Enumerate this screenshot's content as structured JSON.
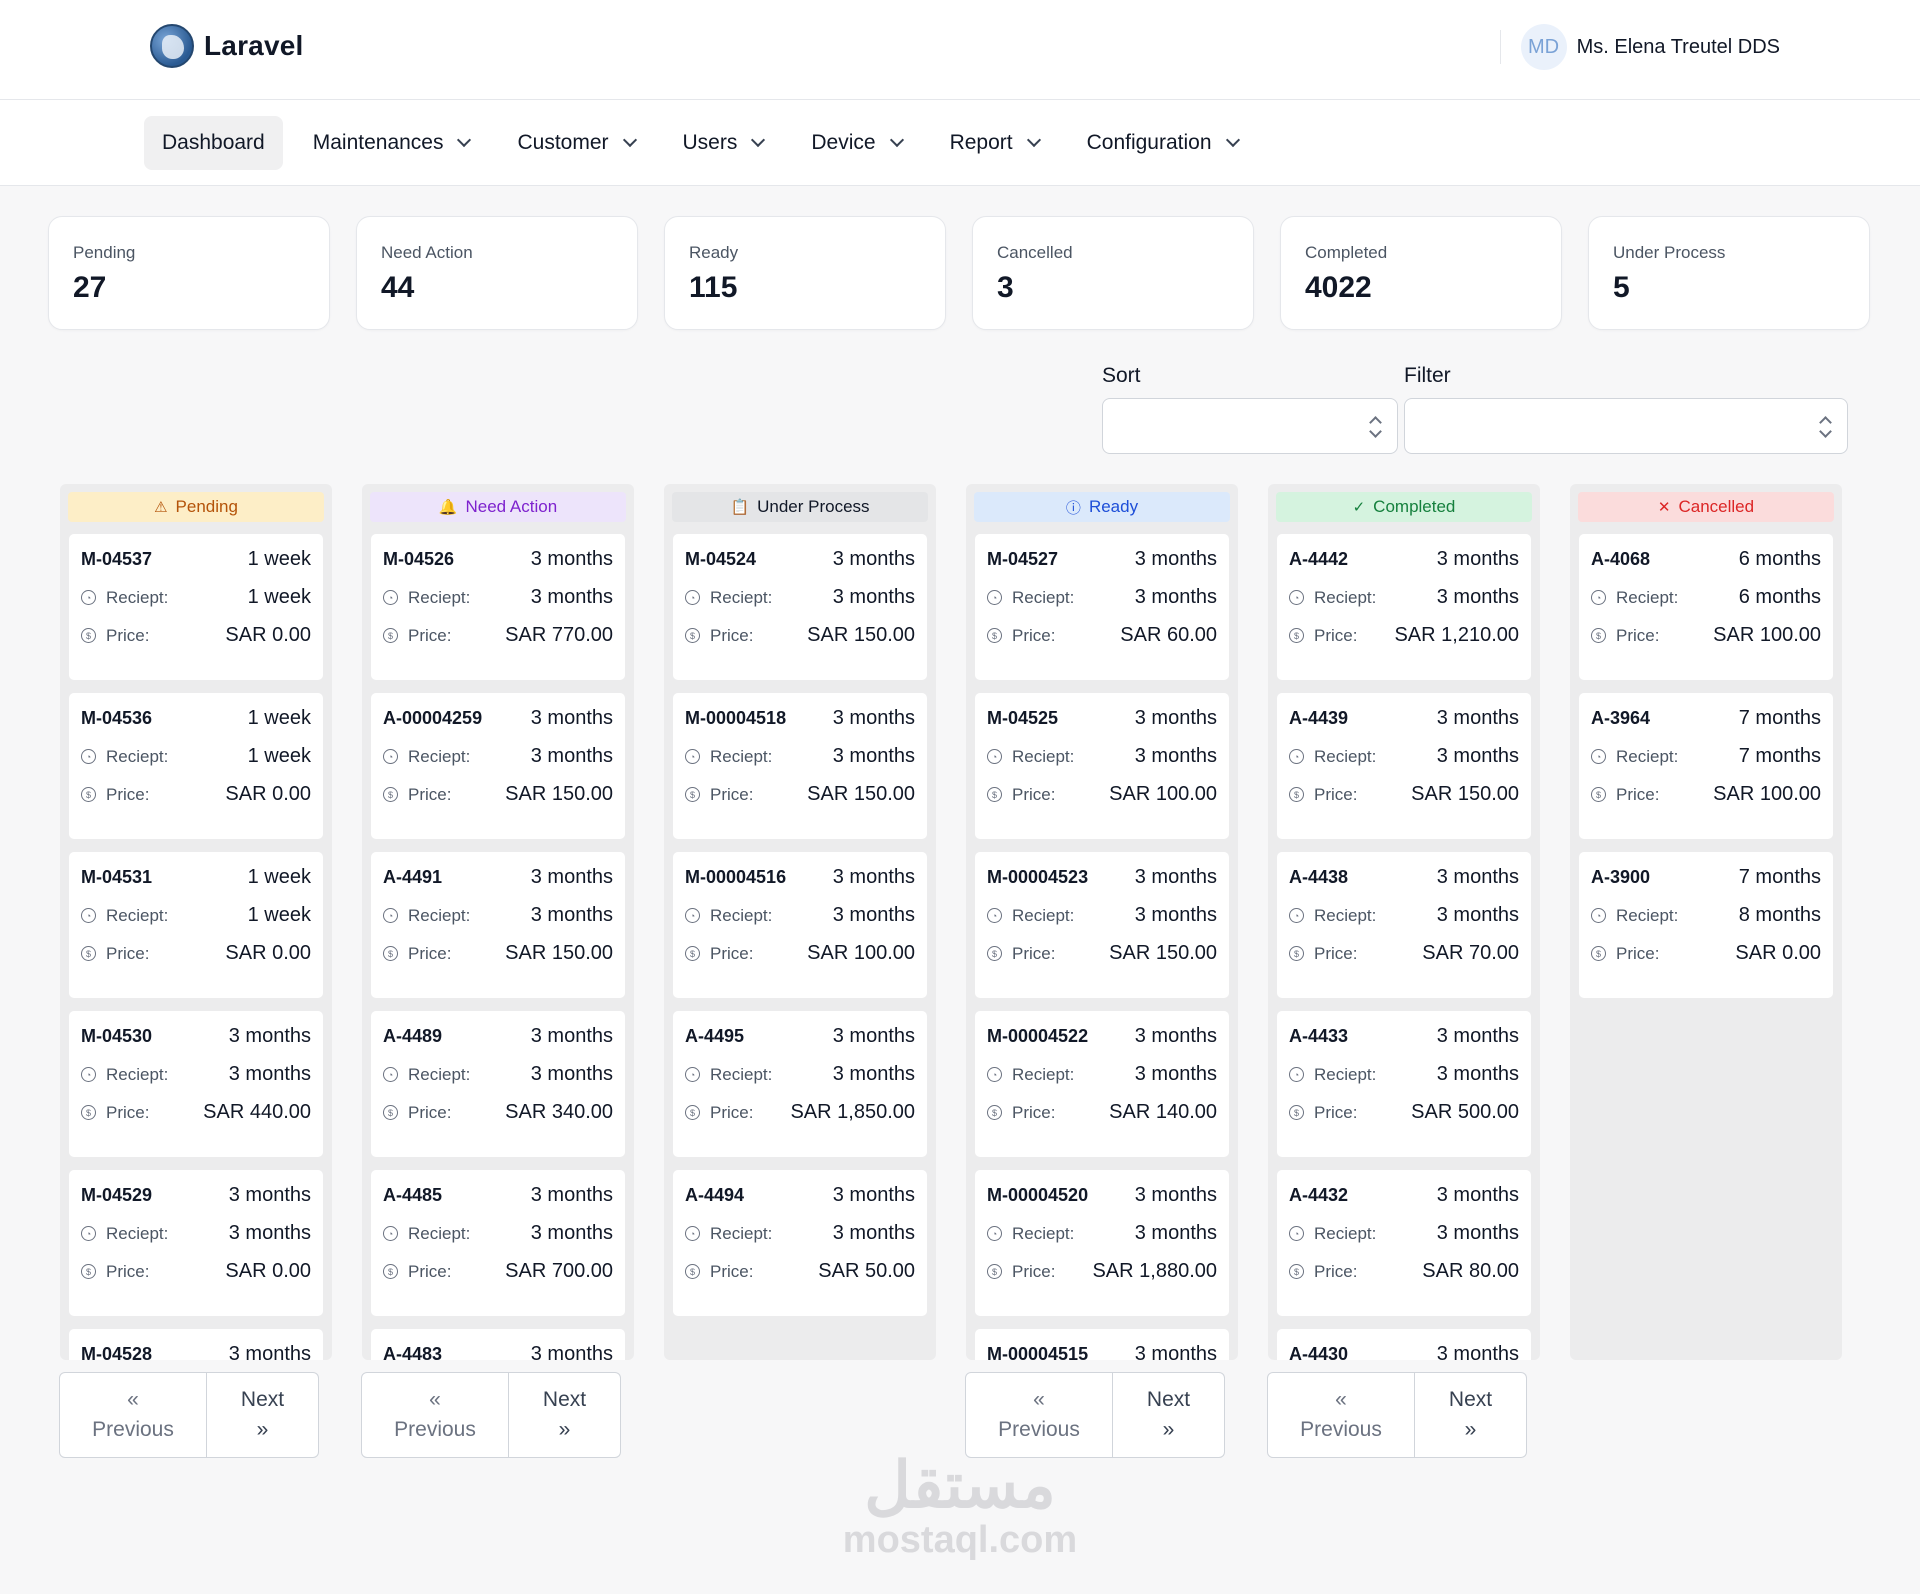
{
  "brand": {
    "name": "Laravel"
  },
  "user": {
    "initials": "MD",
    "name": "Ms. Elena Treutel DDS"
  },
  "nav": [
    {
      "label": "Dashboard"
    },
    {
      "label": "Maintenances"
    },
    {
      "label": "Customer"
    },
    {
      "label": "Users"
    },
    {
      "label": "Device"
    },
    {
      "label": "Report"
    },
    {
      "label": "Configuration"
    }
  ],
  "stats": [
    {
      "label": "Pending",
      "value": "27"
    },
    {
      "label": "Need Action",
      "value": "44"
    },
    {
      "label": "Ready",
      "value": "115"
    },
    {
      "label": "Cancelled",
      "value": "3"
    },
    {
      "label": "Completed",
      "value": "4022"
    },
    {
      "label": "Under Process",
      "value": "5"
    }
  ],
  "controls": {
    "sort_label": "Sort",
    "filter_label": "Filter",
    "sort_value": "",
    "filter_value": ""
  },
  "labels": {
    "receipt": "Reciept:",
    "price": "Price:"
  },
  "pager": {
    "prev_symbol": "«",
    "prev_label": "Previous",
    "next_label": "Next",
    "next_symbol": "»"
  },
  "columns": [
    {
      "title": "Pending",
      "icon": "warning-icon",
      "glyph": "⚠",
      "bg": "#fdeec7",
      "fg": "#b45309",
      "pager": true,
      "cards": [
        {
          "code": "M-04537",
          "time": "1 week",
          "receipt": "1 week",
          "price": "SAR 0.00"
        },
        {
          "code": "M-04536",
          "time": "1 week",
          "receipt": "1 week",
          "price": "SAR 0.00"
        },
        {
          "code": "M-04531",
          "time": "1 week",
          "receipt": "1 week",
          "price": "SAR 0.00"
        },
        {
          "code": "M-04530",
          "time": "3 months",
          "receipt": "3 months",
          "price": "SAR 440.00"
        },
        {
          "code": "M-04529",
          "time": "3 months",
          "receipt": "3 months",
          "price": "SAR 0.00"
        },
        {
          "code": "M-04528",
          "time": "3 months",
          "receipt": "",
          "price": ""
        }
      ]
    },
    {
      "title": "Need Action",
      "icon": "bell-icon",
      "glyph": "🔔",
      "bg": "#ede4fb",
      "fg": "#7e22ce",
      "pager": true,
      "cards": [
        {
          "code": "M-04526",
          "time": "3 months",
          "receipt": "3 months",
          "price": "SAR 770.00"
        },
        {
          "code": "A-00004259",
          "time": "3 months",
          "receipt": "3 months",
          "price": "SAR 150.00"
        },
        {
          "code": "A-4491",
          "time": "3 months",
          "receipt": "3 months",
          "price": "SAR 150.00"
        },
        {
          "code": "A-4489",
          "time": "3 months",
          "receipt": "3 months",
          "price": "SAR 340.00"
        },
        {
          "code": "A-4485",
          "time": "3 months",
          "receipt": "3 months",
          "price": "SAR 700.00"
        },
        {
          "code": "A-4483",
          "time": "3 months",
          "receipt": "",
          "price": ""
        }
      ]
    },
    {
      "title": "Under Process",
      "icon": "clipboard-icon",
      "glyph": "📋",
      "bg": "#e4e5e7",
      "fg": "#111827",
      "pager": false,
      "cards": [
        {
          "code": "M-04524",
          "time": "3 months",
          "receipt": "3 months",
          "price": "SAR 150.00"
        },
        {
          "code": "M-00004518",
          "time": "3 months",
          "receipt": "3 months",
          "price": "SAR 150.00"
        },
        {
          "code": "M-00004516",
          "time": "3 months",
          "receipt": "3 months",
          "price": "SAR 100.00"
        },
        {
          "code": "A-4495",
          "time": "3 months",
          "receipt": "3 months",
          "price": "SAR 1,850.00"
        },
        {
          "code": "A-4494",
          "time": "3 months",
          "receipt": "3 months",
          "price": "SAR 50.00"
        }
      ]
    },
    {
      "title": "Ready",
      "icon": "info-icon",
      "glyph": "ⓘ",
      "bg": "#dbe9fb",
      "fg": "#1d4ed8",
      "pager": true,
      "cards": [
        {
          "code": "M-04527",
          "time": "3 months",
          "receipt": "3 months",
          "price": "SAR 60.00"
        },
        {
          "code": "M-04525",
          "time": "3 months",
          "receipt": "3 months",
          "price": "SAR 100.00"
        },
        {
          "code": "M-00004523",
          "time": "3 months",
          "receipt": "3 months",
          "price": "SAR 150.00"
        },
        {
          "code": "M-00004522",
          "time": "3 months",
          "receipt": "3 months",
          "price": "SAR 140.00"
        },
        {
          "code": "M-00004520",
          "time": "3 months",
          "receipt": "3 months",
          "price": "SAR 1,880.00"
        },
        {
          "code": "M-00004515",
          "time": "3 months",
          "receipt": "",
          "price": ""
        }
      ]
    },
    {
      "title": "Completed",
      "icon": "check-icon",
      "glyph": "✓",
      "bg": "#d5f3df",
      "fg": "#15803d",
      "pager": true,
      "cards": [
        {
          "code": "A-4442",
          "time": "3 months",
          "receipt": "3 months",
          "price": "SAR 1,210.00"
        },
        {
          "code": "A-4439",
          "time": "3 months",
          "receipt": "3 months",
          "price": "SAR 150.00"
        },
        {
          "code": "A-4438",
          "time": "3 months",
          "receipt": "3 months",
          "price": "SAR 70.00"
        },
        {
          "code": "A-4433",
          "time": "3 months",
          "receipt": "3 months",
          "price": "SAR 500.00"
        },
        {
          "code": "A-4432",
          "time": "3 months",
          "receipt": "3 months",
          "price": "SAR 80.00"
        },
        {
          "code": "A-4430",
          "time": "3 months",
          "receipt": "",
          "price": ""
        }
      ]
    },
    {
      "title": "Cancelled",
      "icon": "x-icon",
      "glyph": "✕",
      "bg": "#fbdcdc",
      "fg": "#dc2626",
      "pager": false,
      "cards": [
        {
          "code": "A-4068",
          "time": "6 months",
          "receipt": "6 months",
          "price": "SAR 100.00"
        },
        {
          "code": "A-3964",
          "time": "7 months",
          "receipt": "7 months",
          "price": "SAR 100.00"
        },
        {
          "code": "A-3900",
          "time": "7 months",
          "receipt": "8 months",
          "price": "SAR 0.00"
        }
      ]
    }
  ],
  "watermark": {
    "arabic": "مستقل",
    "latin": "mostaql.com"
  }
}
